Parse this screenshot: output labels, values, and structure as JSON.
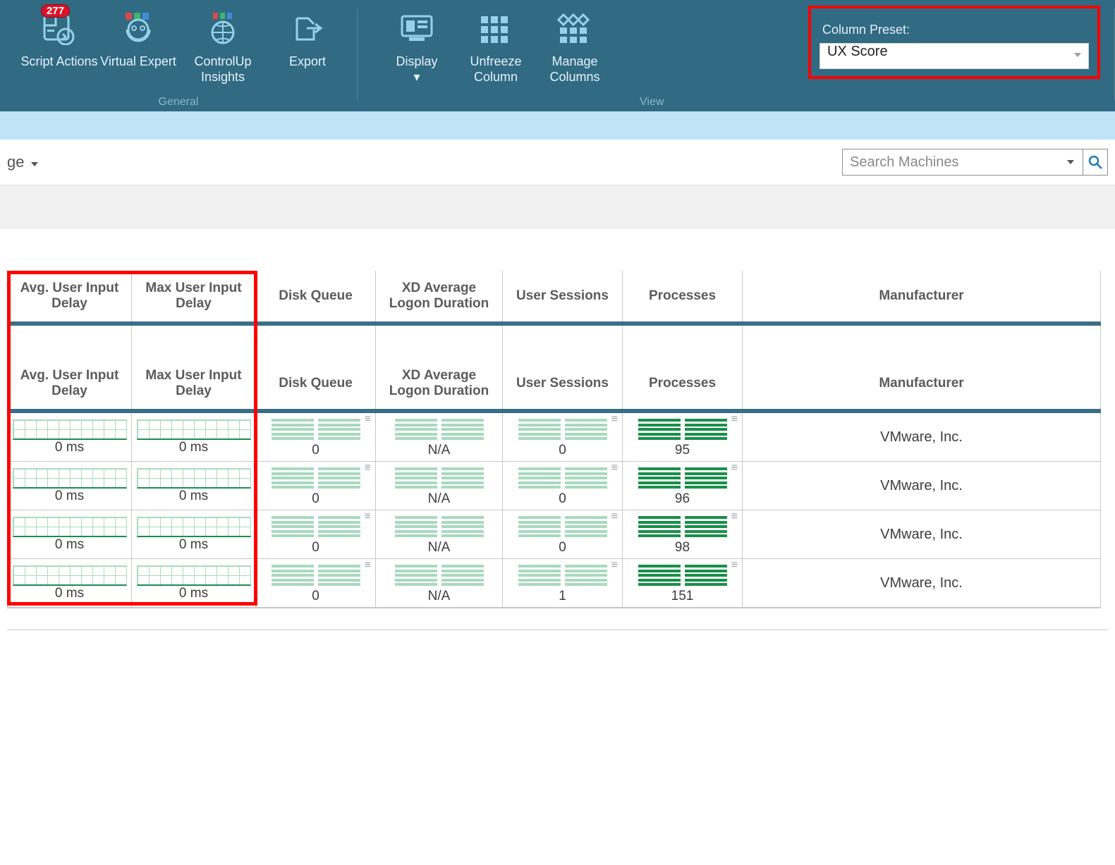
{
  "ribbon": {
    "badge": "277",
    "buttons": {
      "script_actions": "Script Actions",
      "virtual_expert": "Virtual Expert",
      "controlup_insights": "ControlUp Insights",
      "export": "Export",
      "display": "Display",
      "unfreeze_column": "Unfreeze Column",
      "manage_columns": "Manage Columns"
    },
    "group_general": "General",
    "group_view": "View",
    "preset_label": "Column Preset:",
    "preset_value": "UX Score"
  },
  "filter": {
    "left_text": "ge",
    "search_placeholder": "Search Machines"
  },
  "columns": {
    "avg_input": "Avg. User Input Delay",
    "max_input": "Max User Input Delay",
    "disk_queue": "Disk Queue",
    "xd_logon": "XD Average Logon Duration",
    "user_sessions": "User Sessions",
    "processes": "Processes",
    "manufacturer": "Manufacturer"
  },
  "rows": [
    {
      "avg": "0 ms",
      "max": "0 ms",
      "dq": "0",
      "xd": "N/A",
      "us": "0",
      "pr": "95",
      "mfr": "VMware, Inc."
    },
    {
      "avg": "0 ms",
      "max": "0 ms",
      "dq": "0",
      "xd": "N/A",
      "us": "0",
      "pr": "96",
      "mfr": "VMware, Inc."
    },
    {
      "avg": "0 ms",
      "max": "0 ms",
      "dq": "0",
      "xd": "N/A",
      "us": "0",
      "pr": "98",
      "mfr": "VMware, Inc."
    },
    {
      "avg": "0 ms",
      "max": "0 ms",
      "dq": "0",
      "xd": "N/A",
      "us": "1",
      "pr": "151",
      "mfr": "VMware, Inc."
    }
  ]
}
